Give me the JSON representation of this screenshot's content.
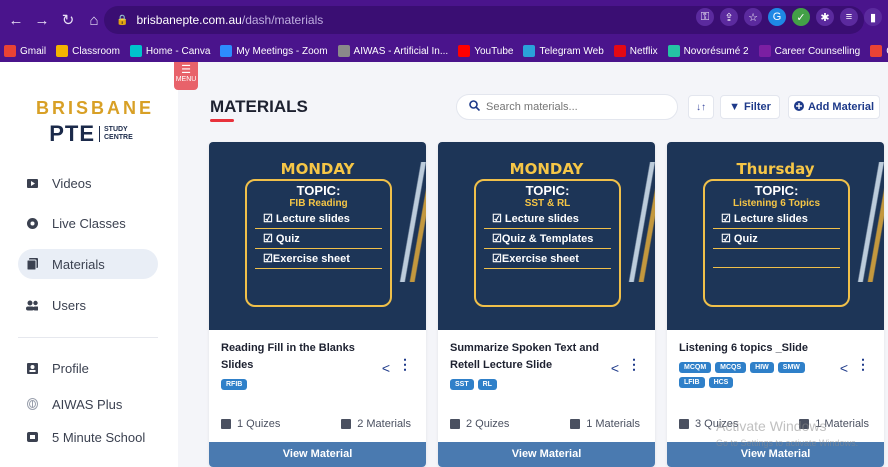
{
  "browser": {
    "url_domain": "brisbanepte.com.au",
    "url_path": "/dash/materials",
    "bookmarks": [
      {
        "label": "Gmail",
        "color": "#ea4335"
      },
      {
        "label": "Classroom",
        "color": "#f4b400"
      },
      {
        "label": "Home - Canva",
        "color": "#00c4cc"
      },
      {
        "label": "My Meetings - Zoom",
        "color": "#2d8cff"
      },
      {
        "label": "AIWAS - Artificial In...",
        "color": "#8a8a8a"
      },
      {
        "label": "YouTube",
        "color": "#ff0000"
      },
      {
        "label": "Telegram Web",
        "color": "#2aa1da"
      },
      {
        "label": "Netflix",
        "color": "#e50914"
      },
      {
        "label": "Novorésumé 2",
        "color": "#25c4a4"
      },
      {
        "label": "Career Counselling",
        "color": "#7b1fa2"
      },
      {
        "label": "Gmail",
        "color": "#ea4335"
      }
    ]
  },
  "sidebar": {
    "menu_toggle": "MENU",
    "logo_line1": "BRISBANE",
    "logo_pte": "PTE",
    "logo_study": "STUDY",
    "logo_centre": "CENTRE",
    "items": [
      {
        "label": "Videos",
        "icon": "video-icon"
      },
      {
        "label": "Live Classes",
        "icon": "live-icon"
      },
      {
        "label": "Materials",
        "icon": "materials-icon",
        "active": true
      },
      {
        "label": "Users",
        "icon": "users-icon"
      },
      {
        "label": "Profile",
        "icon": "profile-icon"
      },
      {
        "label": "AIWAS Plus",
        "icon": "fingerprint-icon"
      },
      {
        "label": "5 Minute School",
        "icon": "school-icon"
      }
    ]
  },
  "header": {
    "title": "MATERIALS",
    "search_placeholder": "Search materials...",
    "sort_label": "↓↑",
    "filter_label": "Filter",
    "add_label": "Add Material"
  },
  "cards": [
    {
      "thumb_day": "MONDAY",
      "thumb_topic": "TOPIC:",
      "thumb_sub": "FIB Reading",
      "thumb_items": [
        "Lecture slides",
        "Quiz",
        "Exercise sheet"
      ],
      "name": "Reading Fill in the Blanks Slides",
      "tags": [
        "RFIB"
      ],
      "quizzes": "1 Quizes",
      "materials": "2 Materials",
      "button": "View Material"
    },
    {
      "thumb_day": "MONDAY",
      "thumb_topic": "TOPIC:",
      "thumb_sub": "SST & RL",
      "thumb_items": [
        "Lecture slides",
        "Quiz & Templates",
        "Exercise sheet"
      ],
      "name": "Summarize Spoken Text and Retell Lecture Slide",
      "tags": [
        "SST",
        "RL"
      ],
      "quizzes": "2 Quizes",
      "materials": "1 Materials",
      "button": "View Material"
    },
    {
      "thumb_day": "Thursday",
      "thumb_topic": "TOPIC:",
      "thumb_sub": "Listening 6 Topics",
      "thumb_items": [
        "Lecture slides",
        "Quiz"
      ],
      "name": "Listening 6 topics _Slide",
      "tags": [
        "MCQM",
        "MCQS",
        "HIW",
        "SMW",
        "LFIB",
        "HCS"
      ],
      "quizzes": "3 Quizes",
      "materials": "1 Materials",
      "button": "View Material"
    }
  ],
  "watermark": {
    "line1": "Activate Windows",
    "line2": "Go to Settings to activate Windows."
  }
}
